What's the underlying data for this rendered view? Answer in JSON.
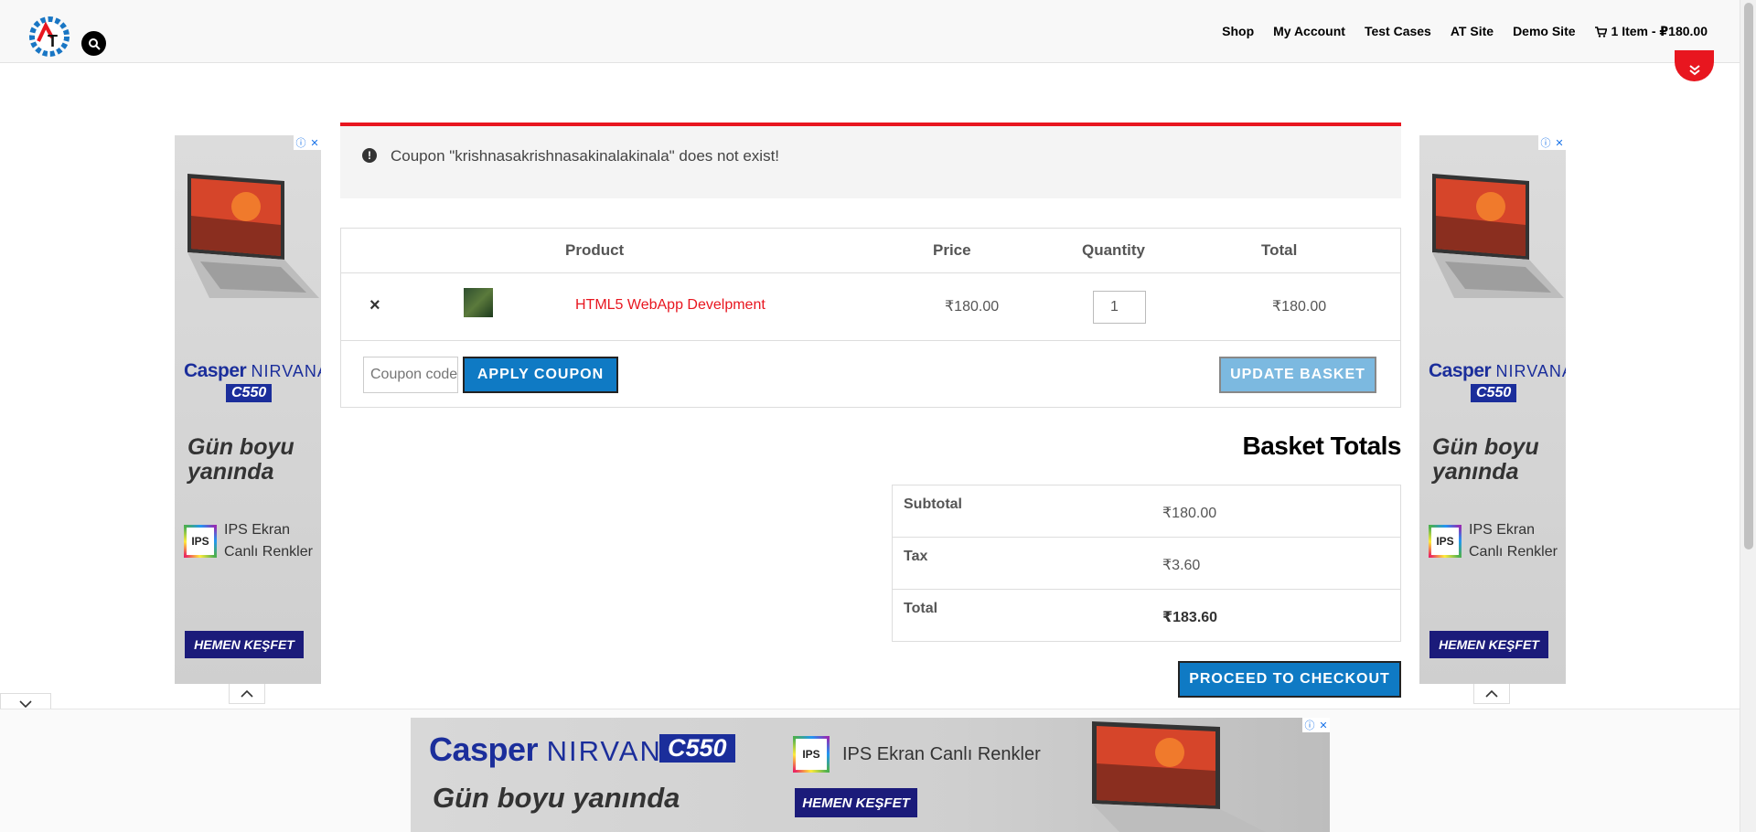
{
  "header": {
    "nav": [
      "Shop",
      "My Account",
      "Test Cases",
      "AT Site",
      "Demo Site"
    ],
    "cart_label": "1 Item - ₽180.00",
    "logo_letters": "AT"
  },
  "notice": {
    "message": "Coupon \"krishnasakrishnasakinalakinala\" does not exist!",
    "icon": "!"
  },
  "cart": {
    "headers": {
      "product": "Product",
      "price": "Price",
      "quantity": "Quantity",
      "total": "Total"
    },
    "item": {
      "remove": "×",
      "name": "HTML5 WebApp Develpment",
      "price": "₹180.00",
      "quantity": "1",
      "total": "₹180.00"
    },
    "coupon_placeholder": "Coupon code",
    "apply_label": "APPLY COUPON",
    "update_label": "UPDATE BASKET"
  },
  "totals": {
    "title": "Basket Totals",
    "rows": [
      {
        "label": "Subtotal",
        "value": "₹180.00"
      },
      {
        "label": "Tax",
        "value": "₹3.60"
      },
      {
        "label": "Total",
        "value": "₹183.60"
      }
    ],
    "checkout_label": "PROCEED TO CHECKOUT"
  },
  "ads": {
    "brand": "Casper",
    "product_line": "NIRVANA",
    "model": "C550",
    "slogan_side": [
      "Gün boyu",
      "yanında"
    ],
    "slogan_banner": "Gün boyu yanında",
    "ips_badge": "IPS",
    "ips_side": [
      "IPS Ekran",
      "Canlı Renkler"
    ],
    "ips_banner": "IPS Ekran Canlı Renkler",
    "cta": "HEMEN KEŞFET",
    "info_icon": "ⓘ",
    "close_icon": "✕"
  },
  "colors": {
    "accent_red": "#e8161f",
    "button_blue": "#0f7ac4",
    "button_blue_disabled": "#7cb9e0",
    "ad_navy": "#1b2e9b"
  }
}
